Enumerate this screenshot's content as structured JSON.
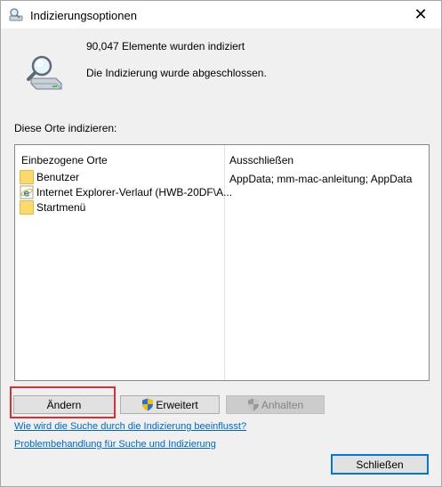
{
  "window": {
    "title": "Indizierungsoptionen",
    "close_glyph": "✕"
  },
  "status": {
    "count_text": "90,047 Elemente wurden indiziert",
    "state_text": "Die Indizierung wurde abgeschlossen.",
    "icon": "magnifier-drive-icon"
  },
  "locations": {
    "label": "Diese Orte indizieren:",
    "columns": {
      "included": "Einbezogene Orte",
      "excluded": "Ausschließen"
    },
    "rows": [
      {
        "name": "Benutzer",
        "icon": "folder-icon",
        "excluded": "AppData; mm-mac-anleitung; AppData"
      },
      {
        "name": "Internet Explorer-Verlauf (HWB-20DF\\A...",
        "icon": "internet-explorer-icon",
        "excluded": ""
      },
      {
        "name": "Startmenü",
        "icon": "folder-icon",
        "excluded": ""
      }
    ]
  },
  "buttons": {
    "change": "Ändern",
    "advanced": "Erweitert",
    "pause": "Anhalten",
    "close": "Schließen"
  },
  "links": {
    "search_influence": "Wie wird die Suche durch die Indizierung beeinflusst?",
    "troubleshoot": "Problembehandlung für Suche und Indizierung"
  },
  "colors": {
    "link": "#0066cc",
    "highlight": "#d93030",
    "default_button_border": "#0078d7"
  }
}
